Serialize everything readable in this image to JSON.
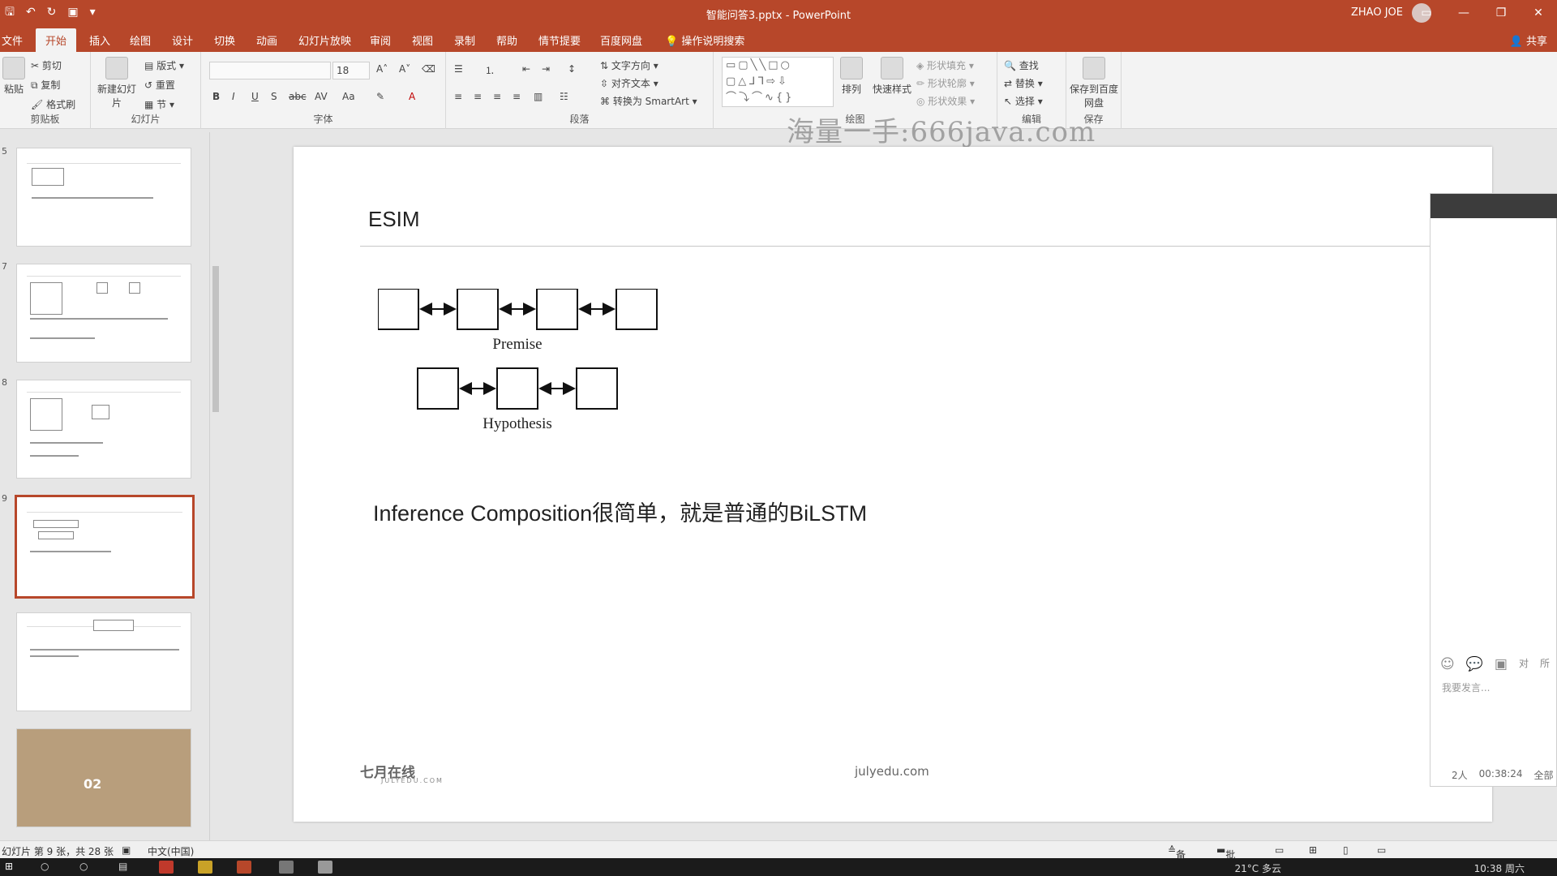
{
  "window": {
    "title": "智能问答3.pptx - PowerPoint",
    "user": "ZHAO JOE"
  },
  "ribbon_tabs": [
    "文件",
    "开始",
    "插入",
    "绘图",
    "设计",
    "切换",
    "动画",
    "幻灯片放映",
    "审阅",
    "视图",
    "录制",
    "帮助",
    "情节提要",
    "百度网盘"
  ],
  "tell_me": "操作说明搜索",
  "share": "共享",
  "ribbon": {
    "clipboard": {
      "paste": "粘贴",
      "cut": "剪切",
      "copy": "复制",
      "format_painter": "格式刷",
      "label": "剪贴板"
    },
    "slides": {
      "new_slide": "新建幻灯片",
      "layout": "版式",
      "reset": "重置",
      "section": "节",
      "label": "幻灯片"
    },
    "font": {
      "size": "18",
      "label": "字体"
    },
    "paragraph": {
      "text_direction": "文字方向",
      "align_text": "对齐文本",
      "convert_smartart": "转换为 SmartArt",
      "label": "段落"
    },
    "drawing": {
      "arrange": "排列",
      "quick_styles": "快速样式",
      "fill": "形状填充",
      "outline": "形状轮廓",
      "effects": "形状效果",
      "label": "绘图"
    },
    "editing": {
      "find": "查找",
      "replace": "替换",
      "select": "选择",
      "label": "编辑"
    },
    "save": {
      "save_to_baidu": "保存到百度网盘",
      "label": "保存"
    }
  },
  "watermark": "海量一手:666java.com",
  "thumbnails": [
    {
      "number": "5"
    },
    {
      "number": "7"
    },
    {
      "number": "8"
    },
    {
      "number": "9",
      "selected": true
    },
    {
      "number": ""
    },
    {
      "number": "",
      "big": "02"
    }
  ],
  "slide": {
    "title": "ESIM",
    "premise_label": "Premise",
    "hypothesis_label": "Hypothesis",
    "body": "Inference Composition很简单，就是普通的BiLSTM",
    "logo": "七月在线",
    "logo_sub": "JULYEDU.COM",
    "footer_url": "julyedu.com"
  },
  "chat": {
    "input_placeholder": "我要发言...",
    "count": "2人",
    "time": "00:38:24",
    "action": "全部",
    "side_labels": [
      "对",
      "所"
    ]
  },
  "status": {
    "slide_info": "幻灯片 第 9 张，共 28 张",
    "language": "中文(中国)",
    "notes": "备注",
    "comments": "批注"
  },
  "taskbar": {
    "weather": "21°C 多云",
    "time": "10:38 周六"
  }
}
